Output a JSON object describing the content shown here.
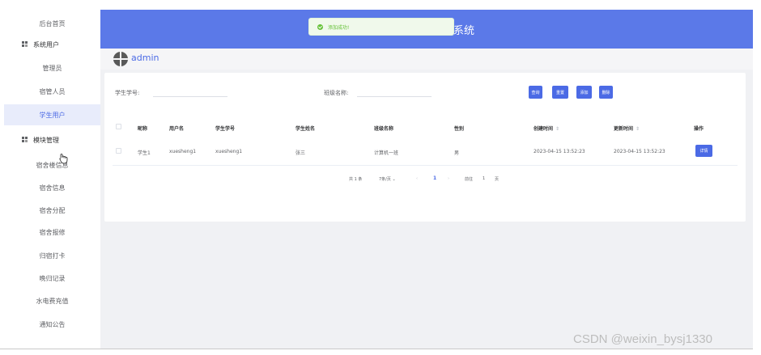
{
  "sidebar": {
    "items": [
      {
        "label": "后台首页"
      },
      {
        "label": "系统用户"
      },
      {
        "label": "管理员"
      },
      {
        "label": "宿管人员"
      },
      {
        "label": "学生用户"
      },
      {
        "label": "模块管理"
      },
      {
        "label": "宿舍楼信息"
      },
      {
        "label": "宿舍信息"
      },
      {
        "label": "宿舍分配"
      },
      {
        "label": "宿舍报修"
      },
      {
        "label": "归宿打卡"
      },
      {
        "label": "晚归记录"
      },
      {
        "label": "水电费充值"
      },
      {
        "label": "通知公告"
      }
    ],
    "active_item": "学生用户"
  },
  "header": {
    "title": "系统",
    "color": "#5b79e8"
  },
  "toast": {
    "message": "添加成功!",
    "icon": "success-check-icon"
  },
  "userbar": {
    "username": "admin",
    "avatar_icon": "avatar-icon"
  },
  "search": {
    "student_no_label": "学生学号:",
    "class_name_label": "班级名称:",
    "student_no_value": "",
    "class_name_value": ""
  },
  "toolbar": {
    "query_label": "查询",
    "reset_label": "重置",
    "add_label": "添加",
    "delete_label": "删除"
  },
  "table": {
    "headers": {
      "nickname": "昵称",
      "username": "用户名",
      "student_no": "学生学号",
      "student_name": "学生姓名",
      "class_name": "班级名称",
      "gender": "性别",
      "created": "创建时间",
      "updated": "更新时间",
      "action": "操作"
    },
    "rows": [
      {
        "nickname": "学生1",
        "username": "xuesheng1",
        "student_no": "xuesheng1",
        "student_name": "张三",
        "class_name": "计算机一班",
        "gender": "男",
        "created": "2023-04-15 13:52:23",
        "updated": "2023-04-15 13:52:23",
        "action": "详情"
      }
    ],
    "sort_glyph": "⇕"
  },
  "pagination": {
    "total": "共 1 条",
    "page_size": "7条/页",
    "size_arrow": "⌄",
    "prev": "‹",
    "current": "1",
    "next": "›",
    "goto_label": "前往",
    "goto_value": "1",
    "page_suffix": "页"
  },
  "watermark": "CSDN @weixin_bysj1330",
  "colors": {
    "primary": "#4b6ae5",
    "success": "#67c23a"
  }
}
